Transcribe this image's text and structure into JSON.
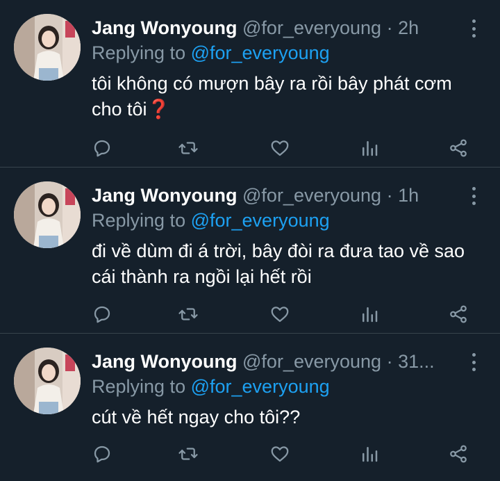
{
  "tweets": [
    {
      "name": "Jang Wonyoung",
      "handle": "@for_everyoung",
      "separator": "·",
      "time": "2h",
      "reply_label": "Replying to",
      "reply_to": "@for_everyoung",
      "text": "tôi không có mượn bây ra rồi bây phát cơm cho tôi❓"
    },
    {
      "name": "Jang Wonyoung",
      "handle": "@for_everyoung",
      "separator": "·",
      "time": "1h",
      "reply_label": "Replying to",
      "reply_to": "@for_everyoung",
      "text": "đi về dùm đi á trời, bây đòi ra đưa tao về sao cái thành ra ngồi lại hết rồi"
    },
    {
      "name": "Jang Wonyoung",
      "handle": "@for_everyoung",
      "separator": "·",
      "time": "31...",
      "reply_label": "Replying to",
      "reply_to": "@for_everyoung",
      "text": "cút về hết ngay cho tôi??"
    }
  ],
  "icons": {
    "more": "more-vertical-icon",
    "reply": "reply-bubble-icon",
    "retweet": "retweet-icon",
    "like": "heart-icon",
    "stats": "analytics-icon",
    "share": "share-icon"
  },
  "colors": {
    "background": "#15202b",
    "divider": "#38444d",
    "secondary_text": "#8899a6",
    "mention": "#1da1f2",
    "primary_text": "#ffffff",
    "question_mark": "#e0245e"
  }
}
